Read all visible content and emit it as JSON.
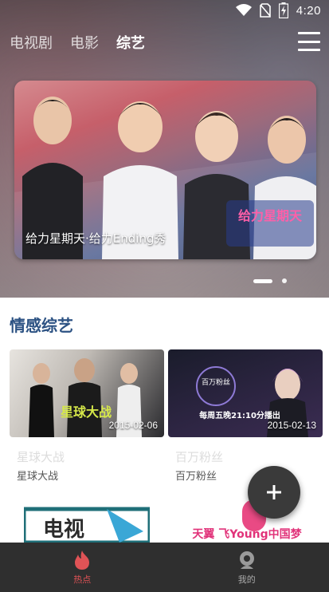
{
  "status_bar": {
    "time": "4:20",
    "icons": [
      "wifi-icon",
      "no-sim-icon",
      "battery-charging-icon"
    ]
  },
  "tabs": [
    {
      "label": "电视剧",
      "active": false
    },
    {
      "label": "电影",
      "active": false
    },
    {
      "label": "综艺",
      "active": true
    }
  ],
  "menu_icon": "hamburger-menu-icon",
  "banner": {
    "caption": "给力星期天·给力Ending秀",
    "logo_text": "给力星期天",
    "page_count": 2,
    "current_page": 1
  },
  "section": {
    "title": "情感综艺",
    "items": [
      {
        "title": "星球大战",
        "subtitle": "星球大战",
        "date": "2015-02-06",
        "poster_text": "星球大战"
      },
      {
        "title": "百万粉丝",
        "subtitle": "百万粉丝",
        "date": "2015-02-13",
        "poster_text": "每周五晚21:10分播出",
        "logo_text": "百万粉丝"
      }
    ],
    "next_row": [
      {
        "poster_text": "电视"
      },
      {
        "poster_text": "天翼 飞Young中国梦"
      }
    ]
  },
  "fab": {
    "icon": "plus-icon"
  },
  "bottom_nav": [
    {
      "label": "热点",
      "icon": "flame-icon",
      "active": true
    },
    {
      "label": "我的",
      "icon": "user-icon",
      "active": false
    }
  ],
  "colors": {
    "accent": "#e05356",
    "section_title": "#2c5283",
    "nav_bg": "#2f2f2f",
    "fab_bg": "#3a3a3a"
  }
}
